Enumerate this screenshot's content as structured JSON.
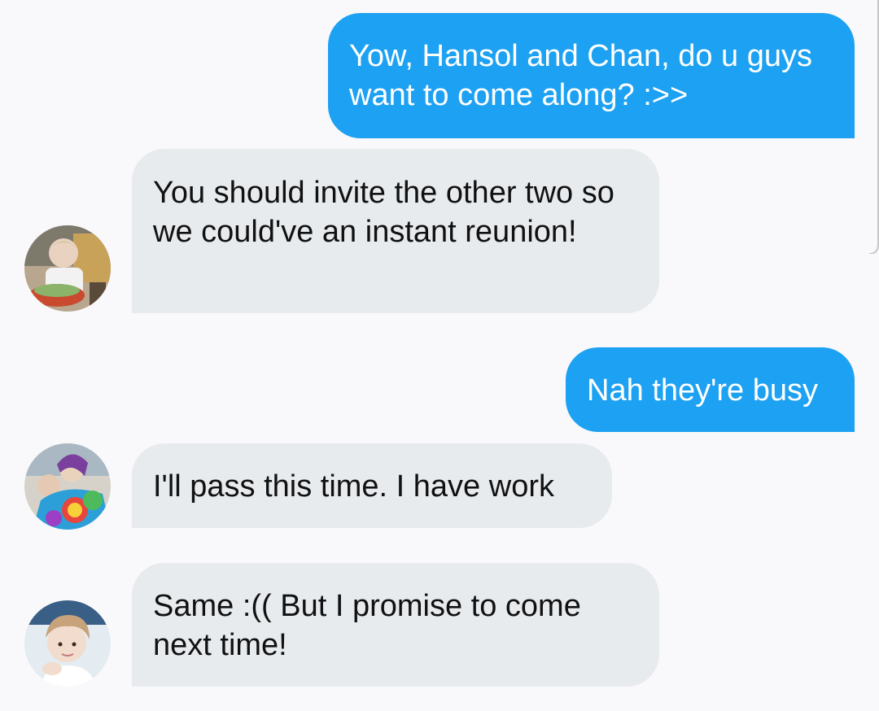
{
  "messages": [
    {
      "direction": "sent",
      "text": "Yow, Hansol and Chan, do u guys want to come along? :>>"
    },
    {
      "direction": "received",
      "avatar": "avatar-photo-1",
      "text": "You should invite the other two so we could've an instant reunion!"
    },
    {
      "direction": "sent",
      "text": "Nah they're busy"
    },
    {
      "direction": "received",
      "avatar": "avatar-photo-2",
      "text": "I'll pass this time. I have work"
    },
    {
      "direction": "received",
      "avatar": "avatar-photo-3",
      "text": "Same :(( But I promise to come next time!"
    }
  ],
  "colors": {
    "background": "#f9f9fb",
    "sent_bubble": "#1da1f2",
    "received_bubble": "#e8ebee",
    "sent_text": "#ffffff",
    "received_text": "#111111"
  }
}
